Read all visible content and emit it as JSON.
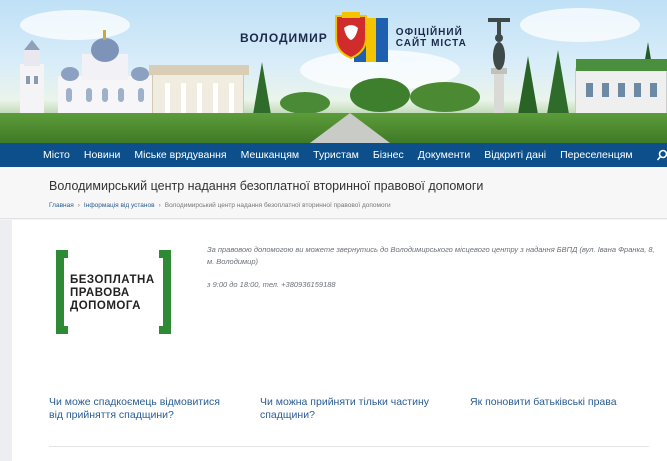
{
  "banner": {
    "city_name": "ВОЛОДИМИР",
    "official_site": "ОФІЦІЙНИЙ САЙТ МІСТА",
    "colors": {
      "sky": "#cfe7f7",
      "grass": "#4f8f34",
      "shield_red": "#d12c2c",
      "flag_blue": "#1f5fb0",
      "flag_yellow": "#f5c400"
    }
  },
  "nav": {
    "items": [
      "Місто",
      "Новини",
      "Міське врядування",
      "Мешканцям",
      "Туристам",
      "Бізнес",
      "Документи",
      "Відкриті дані",
      "Переселенцям"
    ],
    "search_icon": "search-icon",
    "color": "#0d4f8a"
  },
  "page": {
    "title": "Володимирський центр надання безоплатної вторинної правової допомоги",
    "breadcrumb": [
      "Главная",
      "Інформація від установ",
      "Володимирський центр надання безоплатної вторинної правової допомоги"
    ]
  },
  "promo": {
    "line1": "БЕЗОПЛАТНА",
    "line2": "ПРАВОВА",
    "line3": "ДОПОМОГА",
    "color": "#2f8a36"
  },
  "info": {
    "address": "За правовою допомогою ви можете звернутись до Володимирського місцевого центру з надання БВПД (вул. Івана Франка, 8, м. Володимир)",
    "hours": "з 9:00 до 18:00, тел. +380936159188"
  },
  "links": [
    {
      "line1": "Чи може спадкоємець відмовитися",
      "line2": "від прийняття спадщини?"
    },
    {
      "line1": "Чи можна прийняти тільки частину",
      "line2": "спадщини?"
    },
    {
      "line1": "Як поновити батьківські права",
      "line2": ""
    }
  ]
}
